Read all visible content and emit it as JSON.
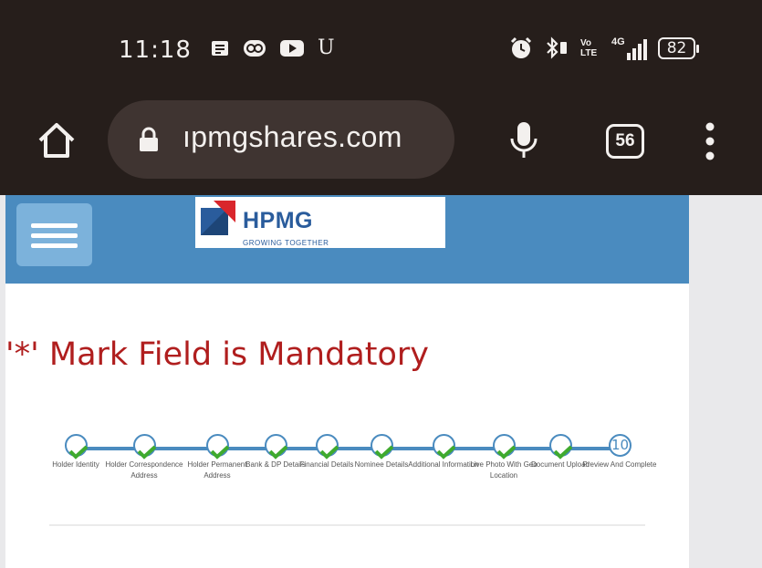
{
  "status_bar": {
    "time": "11:18",
    "left_icons": [
      "notes-icon",
      "sync-icon",
      "youtube-icon",
      "u-icon"
    ],
    "right_icons": [
      "alarm-icon",
      "bluetooth-icon",
      "volte-icon",
      "4g-signal-icon"
    ],
    "volte_label": "Vo LTE",
    "network_label": "4G",
    "battery": "82"
  },
  "browser": {
    "url": "ıpmgshares.com",
    "tab_count": "56"
  },
  "site": {
    "logo_text": "HPMG",
    "logo_tagline": "GROWING TOGETHER",
    "header_color": "#4a8bbf"
  },
  "form": {
    "mandatory_notice": "'*' Mark Field is Mandatory",
    "accent_color": "#b01e1e",
    "steps": [
      {
        "label": "Holder Identity",
        "done": true
      },
      {
        "label": "Holder Correspondence Address",
        "done": true
      },
      {
        "label": "Holder Permanent Address",
        "done": true
      },
      {
        "label": "Bank & DP Details",
        "done": true
      },
      {
        "label": "Financial Details",
        "done": true
      },
      {
        "label": "Nominee Details",
        "done": true
      },
      {
        "label": "Additional Information",
        "done": true
      },
      {
        "label": "Live Photo With Geo Location",
        "done": true
      },
      {
        "label": "Document Upload",
        "done": true
      },
      {
        "label": "Preview And Complete",
        "done": false,
        "number": "10"
      }
    ]
  }
}
